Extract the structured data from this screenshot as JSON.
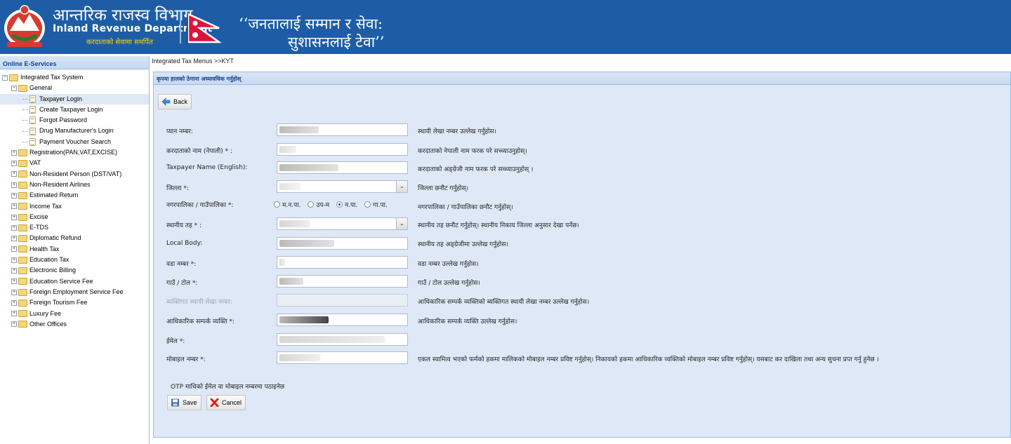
{
  "header": {
    "dept_name_np": "आन्तरिक राजस्व विभाग",
    "dept_name_en": "Inland Revenue Department",
    "tagline": "करदाताको सेवामा समर्पित",
    "motto_line1": "‘‘जनतालाई सम्मान र सेवा:",
    "motto_line2": "सुशासनलाई टेवा’’"
  },
  "sidebar": {
    "title": "Online E-Services",
    "root": "Integrated Tax System",
    "general": "General",
    "general_items": [
      "Taxpayer Login",
      "Create Taxpayer Login",
      "Forgot Password",
      "Drug Manufacturer's Login",
      "Payment Voucher Search"
    ],
    "groups": [
      "Registration(PAN,VAT,EXCISE)",
      "VAT",
      "Non-Resident Person (DST/VAT)",
      "Non-Resident Airlines",
      "Estimated Return",
      "Income Tax",
      "Excise",
      "E-TDS",
      "Diplomatic Refund",
      "Health Tax",
      "Education Tax",
      "Electronic Billing",
      "Education Service Fee",
      "Foreign Employment Service Fee",
      "Foreign Tourism Fee",
      "Luxury Fee",
      "Other Offices"
    ],
    "selected": "Taxpayer Login"
  },
  "main": {
    "breadcrumb": "Integrated Tax Menus >>KYT",
    "panel_title": "कृपया हालको ठेगाना अध्यावधिक गर्नुहोस्",
    "back_label": "Back",
    "save_label": "Save",
    "cancel_label": "Cancel",
    "otp_note": "OTP माथिको ईमेल वा मोबाइल नम्बरमा पठाइनेछ"
  },
  "form": {
    "pan_label": "प्यान नम्बर:",
    "pan_hint": "स्थायी लेखा नम्बर उल्लेख गर्नुहोस।",
    "name_np_label": "करदाताको नाम (नेपाली) * :",
    "name_np_hint": "करदाताको नेपाली नाम फरक परे सच्च्याउनुहोस्।",
    "name_en_label": "Taxpayer Name (English):",
    "name_en_hint": "करदाताको अङ्ग्रेजी नाम फरक परे सच्च्याउनुहोस् ।",
    "district_label": "जिल्ला *:",
    "district_hint": "जिल्ला छनौट गर्नुहोस्।",
    "municipality_label": "नगरपालिका / गाउँपालिका *:",
    "municipality_options": [
      "म.न.पा.",
      "उप-म",
      "न.पा.",
      "गा.पा."
    ],
    "municipality_selected": "न.पा.",
    "municipality_hint": "नगरपालिका / गाउँपालिका छनौट गर्नुहोस्।",
    "local_level_label": "स्थानीय तह * :",
    "local_level_hint": "स्थानीय तह छनौट गर्नुहोस्। स्थानीय निकाय जिल्ला अनुसार देखा पर्नेछ।",
    "local_body_label": "Local Body:",
    "local_body_hint": "स्थानीय तह अङ्ग्रेजीमा उल्लेख गर्नुहोस।",
    "ward_label": "वडा नम्बर *:",
    "ward_hint": "वडा नम्बर उल्लेख गर्नुहोस।",
    "tole_label": "गाउँ / टोल *:",
    "tole_hint": "गाउँ / टोल उल्लेख गर्नुहोस।",
    "personal_pan_label": "ब्यक्तिगत स्थायी लेखा नम्बर:",
    "personal_pan_hint": "आधिकारिक सम्पर्क व्यक्तिको ब्यक्तिगत स्थायी लेखा नम्बर उल्लेख गर्नुहोस।",
    "contact_person_label": "आधिकारिक सम्पर्क व्यक्ति *:",
    "contact_person_hint": "आधिकारिक सम्पर्क व्यक्ति उल्लेख गर्नुहोस।",
    "email_label": "ईमेल *:",
    "mobile_label": "मोबाइल नम्बर *:",
    "mobile_hint": "एकल स्वामित्व भएको फर्मको हकमा मालिकको मोबाइल नम्बर प्रविष्ट गर्नुहोस्। निकायको हकमा आधिकारिक व्यक्तिको मोबाइल नम्बर प्रविष्ट गर्नुहोस्। यसबाट कर दाखिला तथा अन्य सुचना प्रप्त गर्नु हुनेछ ।"
  },
  "colors": {
    "header_bg": "#1e5da6",
    "panel_bg": "#dfe8f6",
    "title_text": "#15428b"
  }
}
